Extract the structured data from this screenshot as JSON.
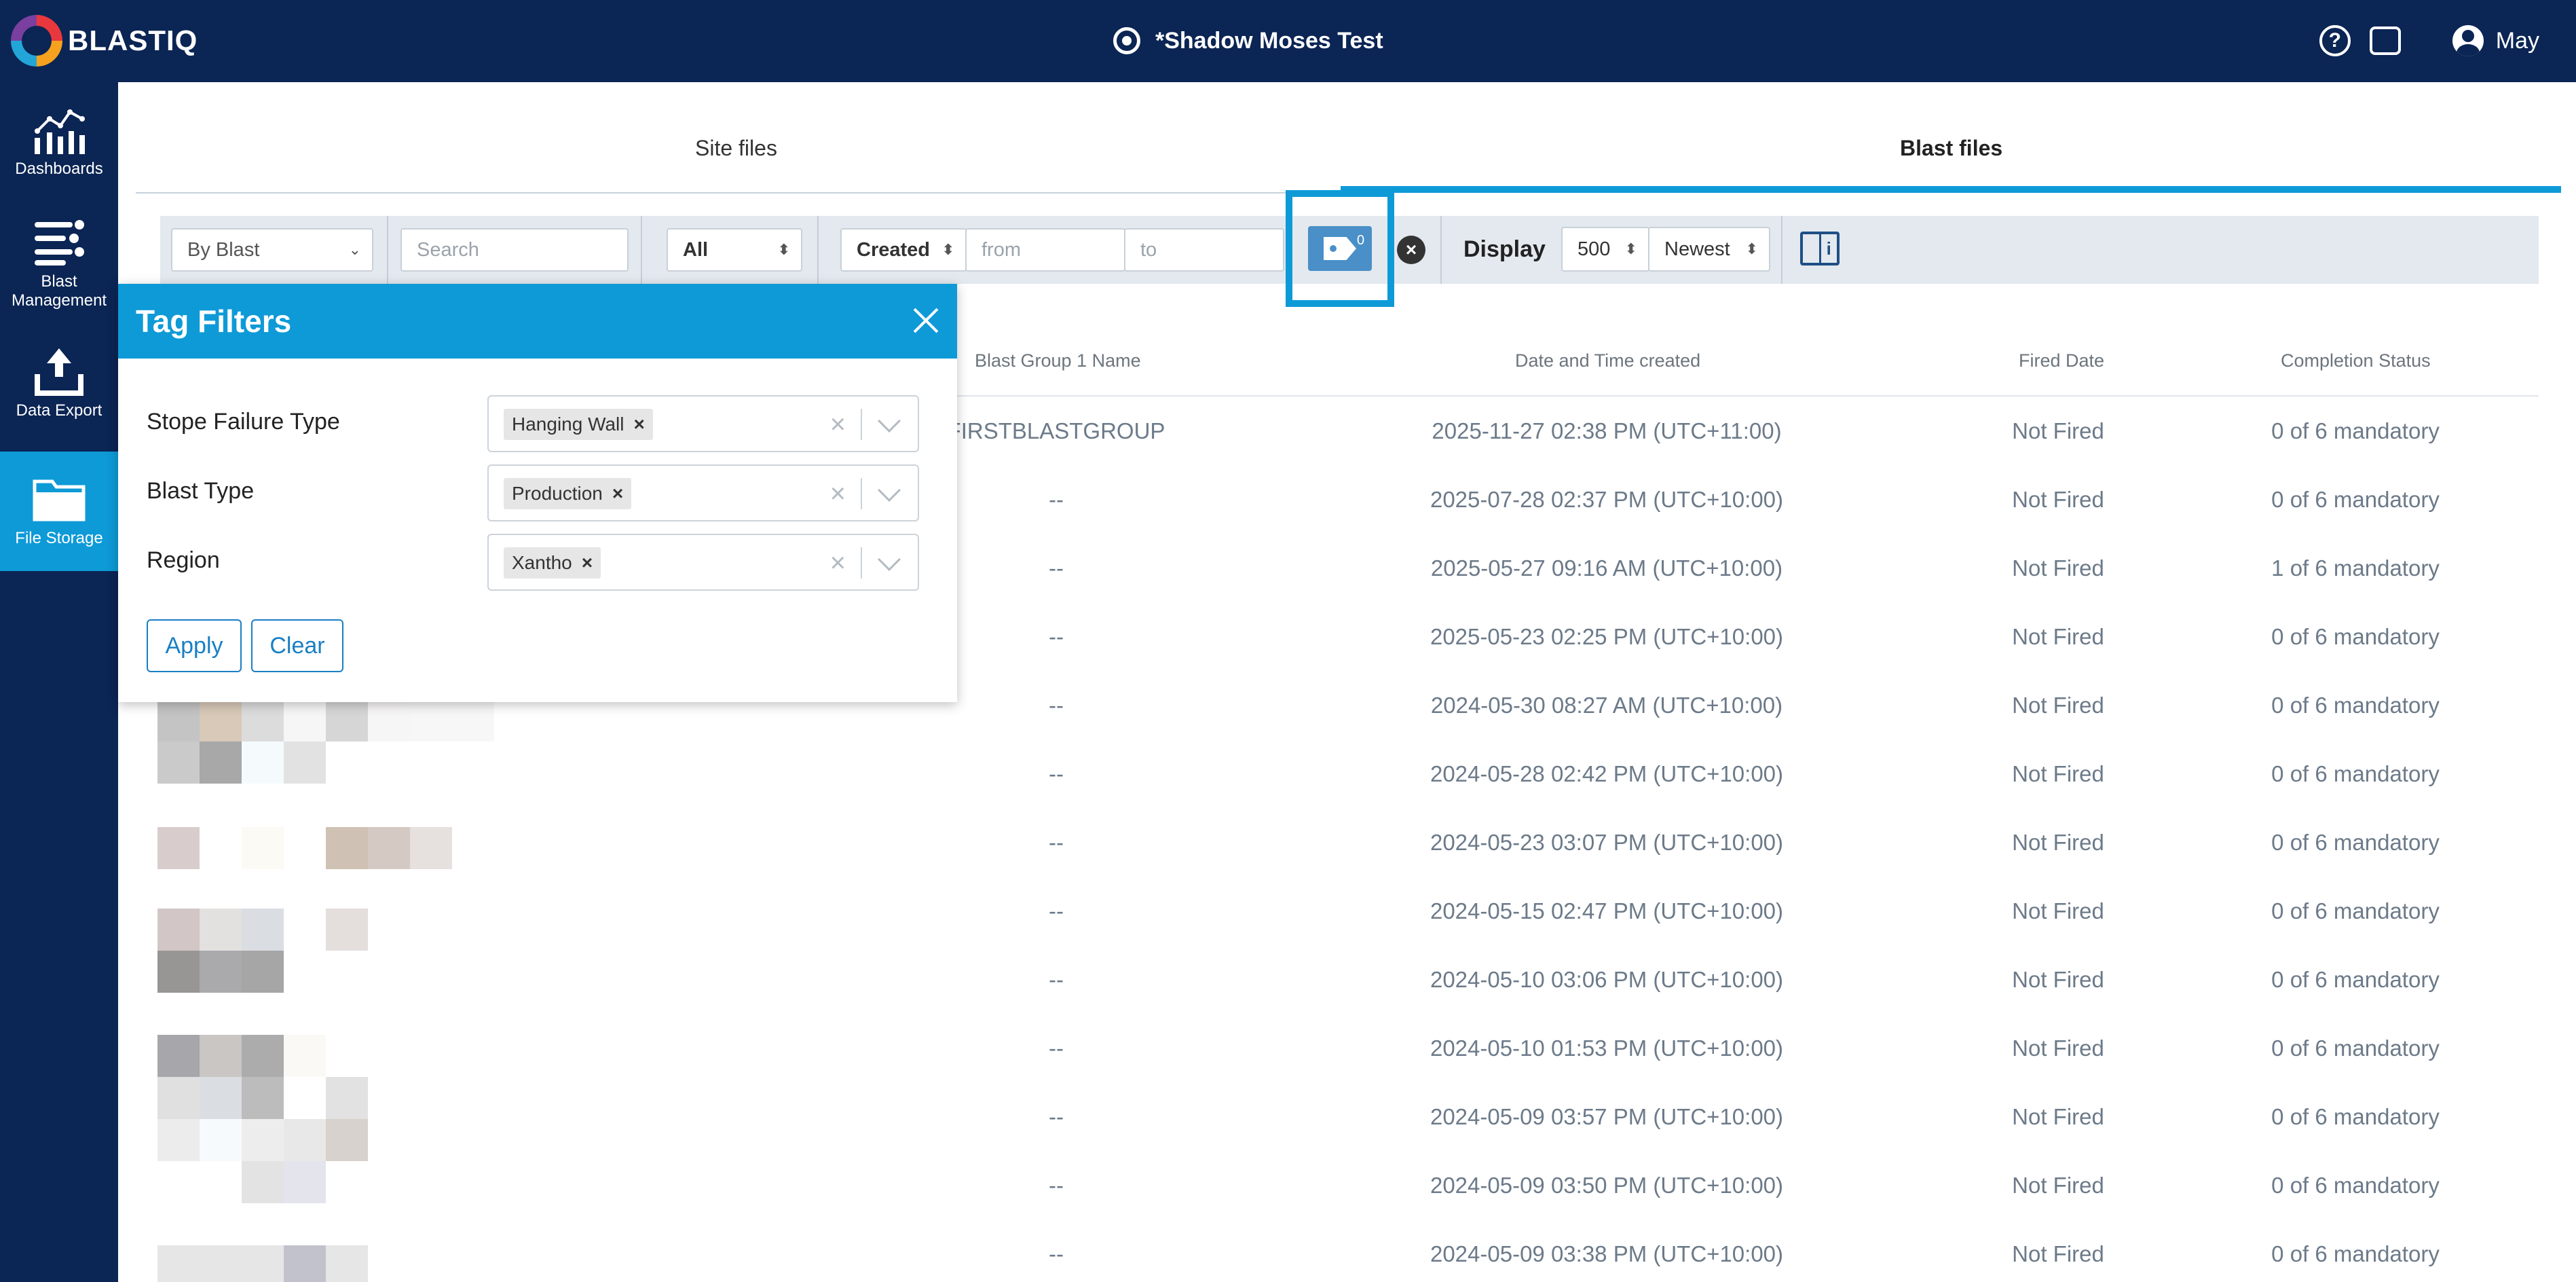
{
  "app": {
    "logo_text": "BLASTIQ",
    "site_title": "*Shadow Moses Test",
    "user_name": "May"
  },
  "sidebar": {
    "items": [
      {
        "label": "Dashboards",
        "icon": "dashboards-icon"
      },
      {
        "label": "Blast Management",
        "icon": "blast-management-icon"
      },
      {
        "label": "Data Export",
        "icon": "upload-icon"
      },
      {
        "label": "File Storage",
        "icon": "folder-icon",
        "active": true
      }
    ]
  },
  "tabs": [
    {
      "label": "Site files",
      "active": false
    },
    {
      "label": "Blast files",
      "active": true
    }
  ],
  "filters": {
    "group_by": "By Blast",
    "search_placeholder": "Search",
    "status": "All",
    "date_field": "Created",
    "from_placeholder": "from",
    "to_placeholder": "to",
    "tag_count": "0",
    "display_label": "Display",
    "page_size": "500",
    "sort": "Newest"
  },
  "table": {
    "columns": [
      "Blast Group 1 Name",
      "Date and Time created",
      "Fired Date",
      "Completion Status"
    ],
    "rows": [
      {
        "group": "FIRSTBLASTGROUP",
        "created": "2025-11-27 02:38 PM (UTC+11:00)",
        "fired": "Not Fired",
        "status": "0 of 6 mandatory"
      },
      {
        "group": "--",
        "created": "2025-07-28 02:37 PM (UTC+10:00)",
        "fired": "Not Fired",
        "status": "0 of 6 mandatory"
      },
      {
        "group": "--",
        "created": "2025-05-27 09:16 AM (UTC+10:00)",
        "fired": "Not Fired",
        "status": "1 of 6 mandatory"
      },
      {
        "group": "--",
        "created": "2025-05-23 02:25 PM (UTC+10:00)",
        "fired": "Not Fired",
        "status": "0 of 6 mandatory"
      },
      {
        "group": "--",
        "created": "2024-05-30 08:27 AM (UTC+10:00)",
        "fired": "Not Fired",
        "status": "0 of 6 mandatory"
      },
      {
        "group": "--",
        "created": "2024-05-28 02:42 PM (UTC+10:00)",
        "fired": "Not Fired",
        "status": "0 of 6 mandatory"
      },
      {
        "group": "--",
        "created": "2024-05-23 03:07 PM (UTC+10:00)",
        "fired": "Not Fired",
        "status": "0 of 6 mandatory"
      },
      {
        "group": "--",
        "created": "2024-05-15 02:47 PM (UTC+10:00)",
        "fired": "Not Fired",
        "status": "0 of 6 mandatory"
      },
      {
        "group": "--",
        "created": "2024-05-10 03:06 PM (UTC+10:00)",
        "fired": "Not Fired",
        "status": "0 of 6 mandatory"
      },
      {
        "group": "--",
        "created": "2024-05-10 01:53 PM (UTC+10:00)",
        "fired": "Not Fired",
        "status": "0 of 6 mandatory"
      },
      {
        "group": "--",
        "created": "2024-05-09 03:57 PM (UTC+10:00)",
        "fired": "Not Fired",
        "status": "0 of 6 mandatory"
      },
      {
        "group": "--",
        "created": "2024-05-09 03:50 PM (UTC+10:00)",
        "fired": "Not Fired",
        "status": "0 of 6 mandatory"
      },
      {
        "group": "--",
        "created": "2024-05-09 03:38 PM (UTC+10:00)",
        "fired": "Not Fired",
        "status": "0 of 6 mandatory"
      }
    ]
  },
  "tag_filters": {
    "title": "Tag Filters",
    "fields": [
      {
        "label": "Stope Failure Type",
        "value": "Hanging Wall"
      },
      {
        "label": "Blast Type",
        "value": "Production"
      },
      {
        "label": "Region",
        "value": "Xantho"
      }
    ],
    "apply_label": "Apply",
    "clear_label": "Clear"
  },
  "colors": {
    "nav": "#0b2554",
    "accent": "#0e9ad7",
    "button_outline": "#1a7fc4"
  }
}
